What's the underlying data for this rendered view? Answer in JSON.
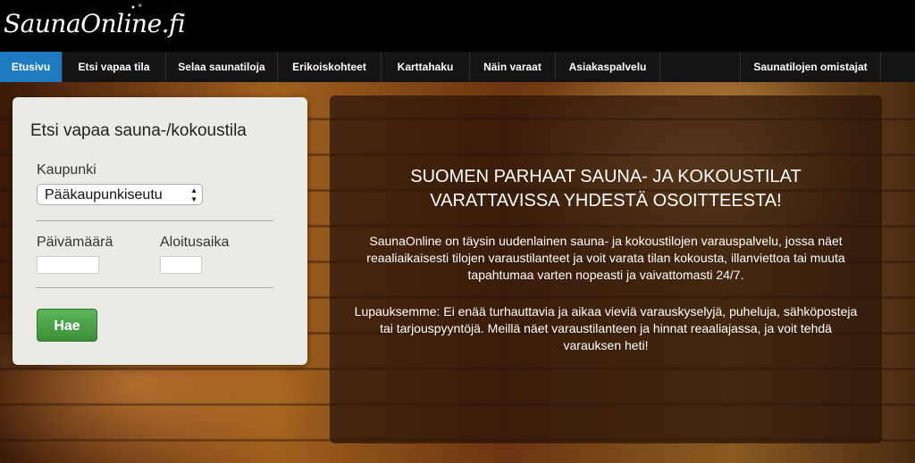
{
  "header": {
    "logo_text": "SaunaOnline.fi"
  },
  "nav": {
    "items": [
      {
        "label": "Etusivu"
      },
      {
        "label": "Etsi vapaa tila"
      },
      {
        "label": "Selaa saunatiloja"
      },
      {
        "label": "Erikoiskohteet"
      },
      {
        "label": "Karttahaku"
      },
      {
        "label": "Näin varaat"
      },
      {
        "label": "Asiakaspalvelu"
      },
      {
        "label": "Saunatilojen omistajat"
      }
    ],
    "active_color": "#1e7bc0"
  },
  "search": {
    "title": "Etsi vapaa sauna-/kokoustila",
    "city_label": "Kaupunki",
    "city_value": "Pääkaupunkiseutu",
    "date_label": "Päivämäärä",
    "time_label": "Aloitusaika",
    "date_value": "",
    "time_value": "",
    "submit_label": "Hae"
  },
  "info": {
    "headline_line1": "SUOMEN PARHAAT SAUNA- JA KOKOUSTILAT",
    "headline_line2": "VARATTAVISSA YHDESTÄ OSOITTEESTA!",
    "paragraph1": "SaunaOnline on täysin uudenlainen sauna- ja kokoustilojen varauspalvelu, jossa näet reaaliaikaisesti tilojen varaustilanteet ja voit varata tilan kokousta, illanviettoa tai muuta tapahtumaa varten nopeasti ja vaivattomasti 24/7.",
    "paragraph2": "Lupauksemme: Ei enää turhauttavia ja aikaa vieviä varauskyselyjä, puheluja, sähköposteja tai tarjouspyyntöjä. Meillä näet varaustilanteen ja hinnat reaaliajassa, ja voit tehdä varauksen heti!"
  },
  "colors": {
    "submit_button": "#4aa046",
    "brand_background": "#000000"
  }
}
